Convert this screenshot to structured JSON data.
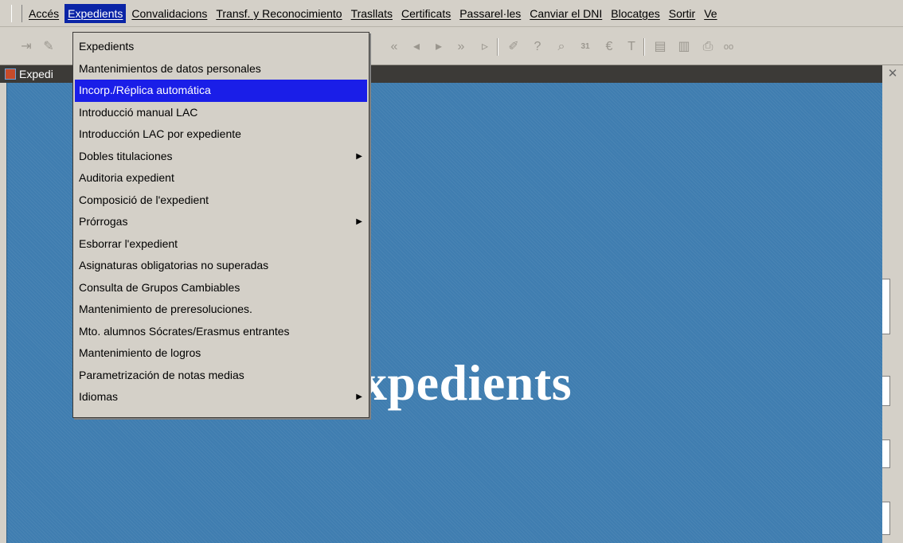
{
  "menubar": {
    "items": [
      {
        "label": "Accés"
      },
      {
        "label": "Expedients"
      },
      {
        "label": "Convalidacions"
      },
      {
        "label": "Transf. y Reconocimiento"
      },
      {
        "label": "Trasllats"
      },
      {
        "label": "Certificats"
      },
      {
        "label": "Passarel·les"
      },
      {
        "label": "Canviar el DNI"
      },
      {
        "label": "Blocatges"
      },
      {
        "label": "Sortir"
      },
      {
        "label": "Ve"
      }
    ],
    "active_index": 1
  },
  "toolbar": {
    "icons": [
      "exit-icon",
      "save-icon",
      "first-record-icon",
      "previous-record-icon",
      "next-record-icon",
      "next-set-icon",
      "last-record-icon",
      "edit-icon",
      "help-icon",
      "query-icon",
      "calendar-icon",
      "euro-icon",
      "t-icon",
      "document-icon",
      "document-icon",
      "print-icon",
      "ool-icon"
    ],
    "calendar_day": "31"
  },
  "window": {
    "title": "Expedi",
    "banner": "xpedients"
  },
  "dropdown": {
    "items": [
      {
        "label": "Expedients"
      },
      {
        "label": "Mantenimientos de datos personales"
      },
      {
        "label": "Incorp./Réplica automática"
      },
      {
        "label": "Introducció manual LAC"
      },
      {
        "label": "Introducción LAC por expediente"
      },
      {
        "label": "Dobles titulaciones",
        "submenu": true
      },
      {
        "label": "Auditoria expedient"
      },
      {
        "label": "Composició de l'expedient"
      },
      {
        "label": "Prórrogas",
        "submenu": true
      },
      {
        "label": "Esborrar l'expedient"
      },
      {
        "label": "Asignaturas obligatorias no superadas"
      },
      {
        "label": "Consulta de Grupos Cambiables"
      },
      {
        "label": "Mantenimiento de preresoluciones."
      },
      {
        "label": "Mto. alumnos Sócrates/Erasmus entrantes"
      },
      {
        "label": "Mantenimiento de logros"
      },
      {
        "label": "Parametrización de notas medias"
      },
      {
        "label": "Idiomas",
        "submenu": true
      }
    ],
    "highlighted_index": 2
  },
  "colors": {
    "chrome": "#d4d0c8",
    "highlight": "#1a1ee8",
    "canvas": "#3f7db0",
    "titlebar": "#3c3a37"
  }
}
